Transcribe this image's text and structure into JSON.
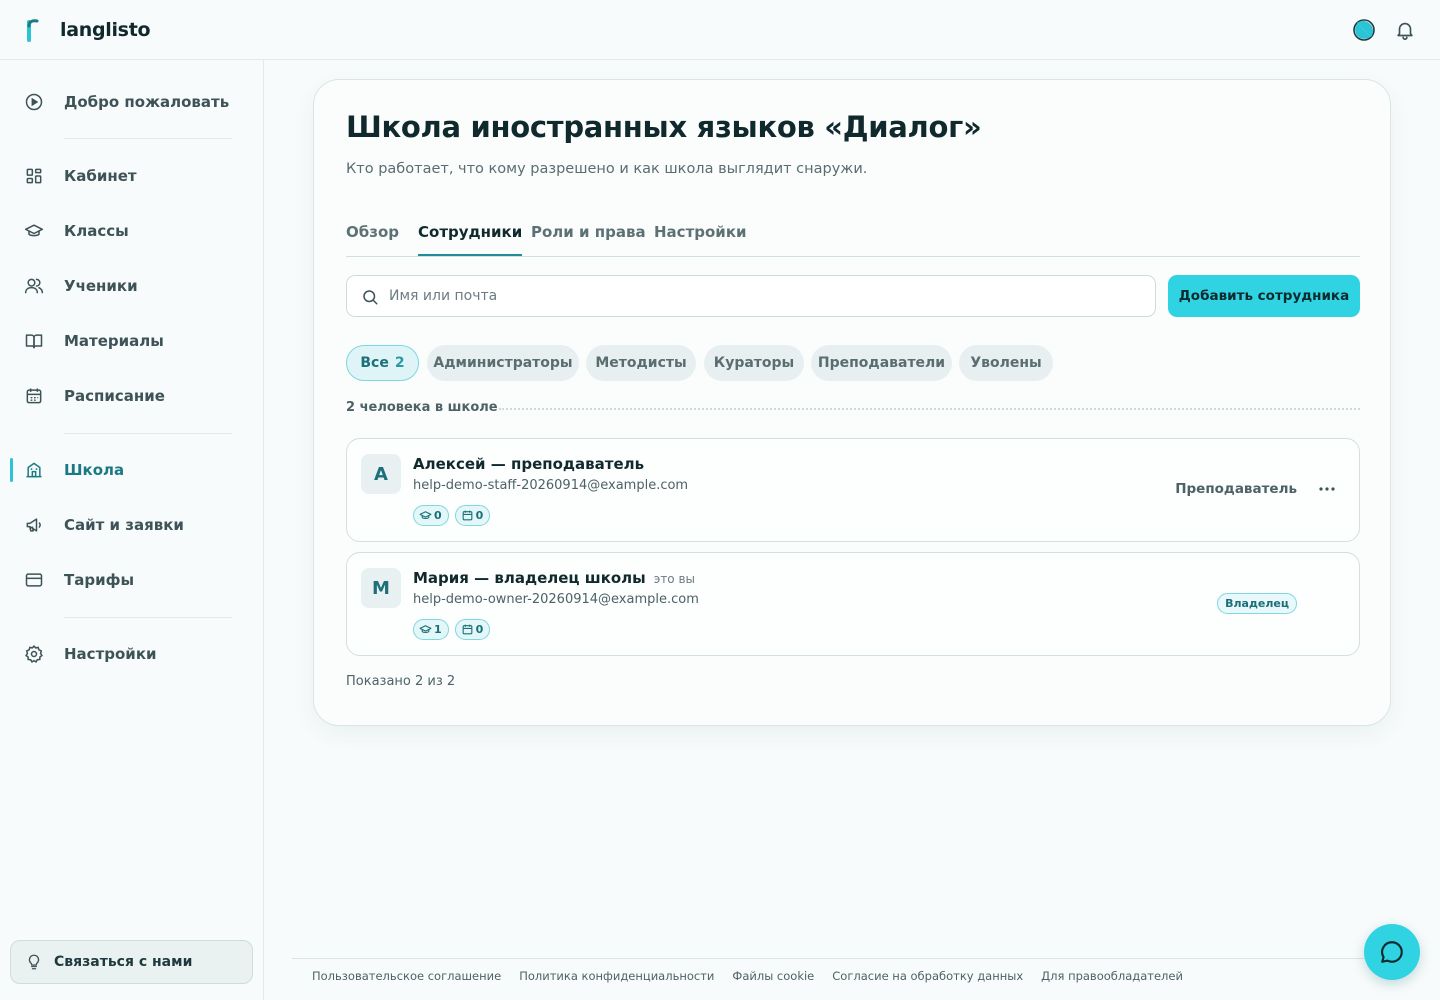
{
  "app": {
    "name": "langlisto"
  },
  "sidebar": {
    "items": [
      {
        "label": "Добро пожаловать",
        "icon": "play-circle-icon"
      },
      {
        "label": "Кабинет",
        "icon": "dashboard-icon"
      },
      {
        "label": "Классы",
        "icon": "graduation-cap-icon"
      },
      {
        "label": "Ученики",
        "icon": "users-icon"
      },
      {
        "label": "Материалы",
        "icon": "book-icon"
      },
      {
        "label": "Расписание",
        "icon": "calendar-icon"
      },
      {
        "label": "Школа",
        "icon": "school-building-icon",
        "active": true
      },
      {
        "label": "Сайт и заявки",
        "icon": "megaphone-icon"
      },
      {
        "label": "Тарифы",
        "icon": "credit-card-icon"
      },
      {
        "label": "Настройки",
        "icon": "gear-icon"
      }
    ],
    "contact_label": "Связаться с нами"
  },
  "page": {
    "title": "Школа иностранных языков «Диалог»",
    "subtitle": "Кто работает, что кому разрешено и как школа выглядит снаружи.",
    "tabs": [
      "Обзор",
      "Сотрудники",
      "Роли и права",
      "Настройки"
    ],
    "active_tab": "Сотрудники"
  },
  "search": {
    "placeholder": "Имя или почта",
    "value": ""
  },
  "add_button": "Добавить сотрудника",
  "filters": [
    {
      "label": "Все",
      "count": "2",
      "active": true
    },
    {
      "label": "Администраторы"
    },
    {
      "label": "Методисты"
    },
    {
      "label": "Кураторы"
    },
    {
      "label": "Преподаватели"
    },
    {
      "label": "Уволены"
    }
  ],
  "count_text": "2 человека в школе",
  "staff": [
    {
      "initial": "А",
      "name": "Алексей — преподаватель",
      "you": "",
      "email": "help-demo-staff-20260914@example.com",
      "classes": "0",
      "lessons": "0",
      "role": "Преподаватель"
    },
    {
      "initial": "М",
      "name": "Мария — владелец школы",
      "you": "это вы",
      "email": "help-demo-owner-20260914@example.com",
      "classes": "1",
      "lessons": "0",
      "role": "Владелец"
    }
  ],
  "shown_text": "Показано 2 из 2",
  "footer": {
    "links": [
      "Пользовательское соглашение",
      "Политика конфиденциальности",
      "Файлы cookie",
      "Согласие на обработку данных",
      "Для правообладателей"
    ]
  },
  "colors": {
    "accent": "#2fd3e2",
    "accent_dark": "#1a7a84",
    "text": "#10292d"
  }
}
